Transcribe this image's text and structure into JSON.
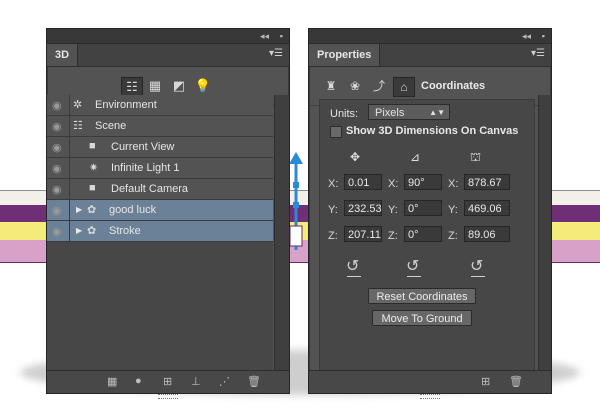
{
  "panel3d": {
    "tab_label": "3D",
    "filter_icons": [
      "scene-tree-icon",
      "mesh-icon",
      "material-icon",
      "light-bulb-icon"
    ],
    "layers": [
      {
        "name": "Environment",
        "icon": "environment-icon",
        "indent": 0,
        "expandable": false,
        "selected": false
      },
      {
        "name": "Scene",
        "icon": "scene-icon",
        "indent": 0,
        "expandable": false,
        "selected": false
      },
      {
        "name": "Current View",
        "icon": "camera-icon",
        "indent": 1,
        "expandable": false,
        "selected": false
      },
      {
        "name": "Infinite Light 1",
        "icon": "sun-light-icon",
        "indent": 1,
        "expandable": false,
        "selected": false
      },
      {
        "name": "Default Camera",
        "icon": "camera-icon",
        "indent": 1,
        "expandable": false,
        "selected": false
      },
      {
        "name": "good luck",
        "icon": "3d-mesh-icon",
        "indent": 0,
        "expandable": true,
        "selected": true
      },
      {
        "name": "Stroke",
        "icon": "3d-mesh-icon",
        "indent": 0,
        "expandable": true,
        "selected": true
      }
    ],
    "bottom_icons": [
      "render-icon",
      "light-icon",
      "add-object-icon",
      "move-to-ground-icon",
      "add-constraint-icon",
      "trash-icon"
    ]
  },
  "properties": {
    "tab_label": "Properties",
    "header_icons": [
      "mesh-prop-icon",
      "deform-icon",
      "cap-icon",
      "coordinates-icon"
    ],
    "section_title": "Coordinates",
    "units_label": "Units:",
    "units_value": "Pixels",
    "show_dims_label": "Show 3D Dimensions On Canvas",
    "position": {
      "x": "0.01",
      "y": "232.53",
      "z": "207.11"
    },
    "rotation": {
      "x": "90°",
      "y": "0°",
      "z": "0°"
    },
    "scale": {
      "x": "878.67",
      "y": "469.06",
      "z": "89.06"
    },
    "axis_labels": {
      "x": "X:",
      "y": "Y:",
      "z": "Z:"
    },
    "reset_button": "Reset Coordinates",
    "ground_button": "Move To Ground",
    "bottom_icons": [
      "add-object-icon",
      "trash-icon"
    ]
  },
  "colors": {
    "panel_bg": "#535353",
    "selected_row": "#6b8197",
    "gizmo_blue": "#2a8ad6"
  }
}
